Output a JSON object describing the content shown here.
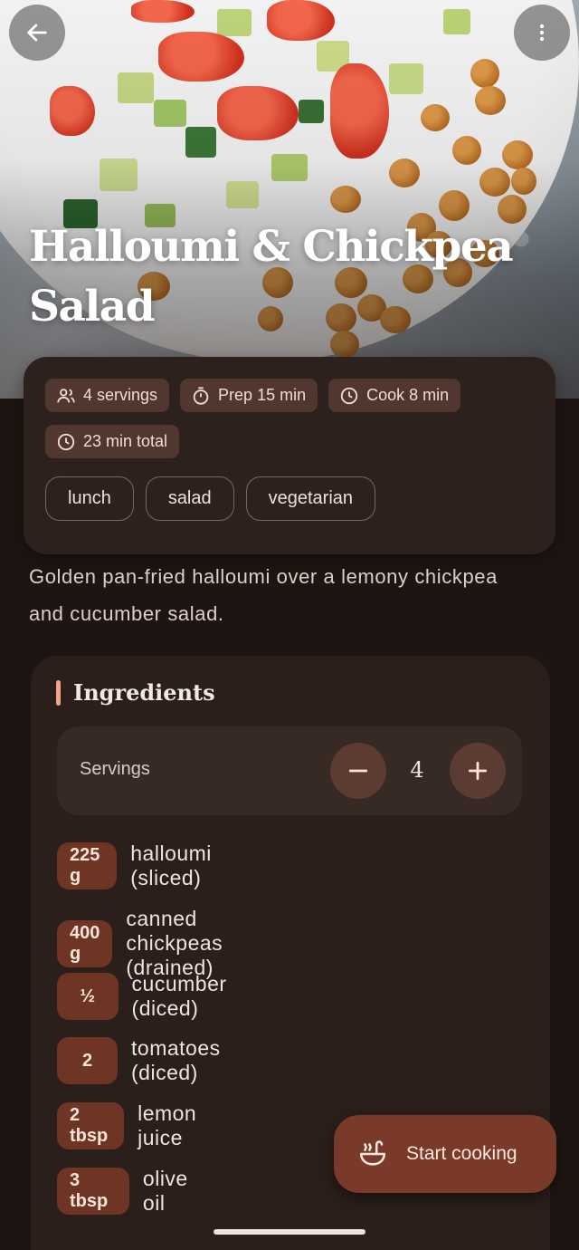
{
  "recipe": {
    "title": "Halloumi & Chickpea Salad",
    "description": "Golden pan-fried halloumi over a lemony chickpea and cucumber salad."
  },
  "meta": {
    "servings": "4 servings",
    "prep": "Prep 15 min",
    "cook": "Cook 8 min",
    "total": "23 min total"
  },
  "tags": [
    "lunch",
    "salad",
    "vegetarian"
  ],
  "ingredients": {
    "heading": "Ingredients",
    "servings_label": "Servings",
    "servings_value": "4",
    "items": [
      {
        "qty": "225 g",
        "name": "halloumi (sliced)"
      },
      {
        "qty": "400 g",
        "name": "canned chickpeas (drained)"
      },
      {
        "qty": "½",
        "name": "cucumber (diced)"
      },
      {
        "qty": "2",
        "name": "tomatoes (diced)"
      },
      {
        "qty": "2 tbsp",
        "name": "lemon juice"
      },
      {
        "qty": "3 tbsp",
        "name": "olive oil"
      }
    ]
  },
  "fab": {
    "label": "Start cooking",
    "icon": "ladle-pot-icon"
  },
  "icons": {
    "back": "arrow-left-icon",
    "menu": "more-vertical-icon",
    "servings": "people-icon",
    "prep": "timer-icon",
    "cook": "clock-icon",
    "total": "clock-icon",
    "decrease": "minus-icon",
    "increase": "plus-icon"
  },
  "colors": {
    "background": "#1e1512",
    "card": "#2d211d",
    "chip": "#51372f",
    "quantity_badge": "#6e3424",
    "fab": "#7a3a2a",
    "accent": "#f0a58a"
  }
}
